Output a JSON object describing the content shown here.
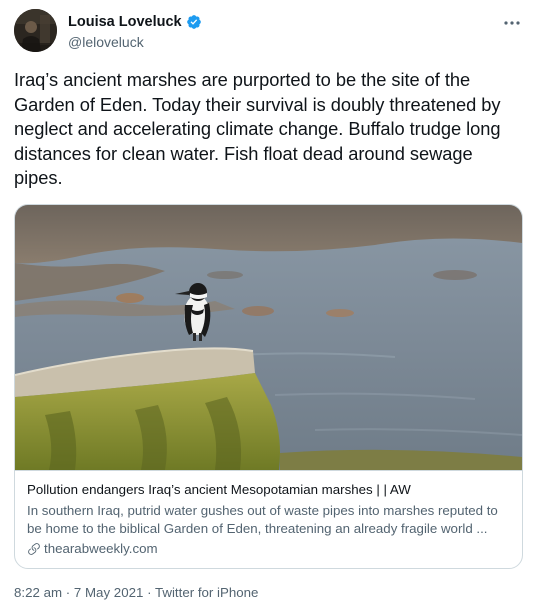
{
  "author": {
    "display_name": "Louisa Loveluck",
    "handle": "@leloveluck",
    "verified": true
  },
  "icons": {
    "verified": "verified-badge-icon",
    "more": "more-options-icon",
    "link": "link-icon"
  },
  "tweet": {
    "text": "Iraq’s ancient marshes are purported to be the site of the Garden of Eden. Today their survival is doubly threatened by neglect and accelerating climate change. Buffalo trudge long distances for clean water. Fish float dead around sewage pipes."
  },
  "card": {
    "title": "Pollution endangers Iraq’s ancient Mesopotamian marshes | | AW",
    "description": "In southern Iraq, putrid water gushes out of waste pipes into marshes reputed to be home to the biblical Garden of Eden, threatening an already fragile world ...",
    "domain": "thearabweekly.com"
  },
  "meta": {
    "time": "8:22 am",
    "separator": "·",
    "date": "7 May 2021",
    "source": "Twitter for iPhone"
  },
  "colors": {
    "text_primary": "#0f1419",
    "text_secondary": "#536471",
    "verified_blue": "#1d9bf0",
    "border": "#cfd9de"
  }
}
